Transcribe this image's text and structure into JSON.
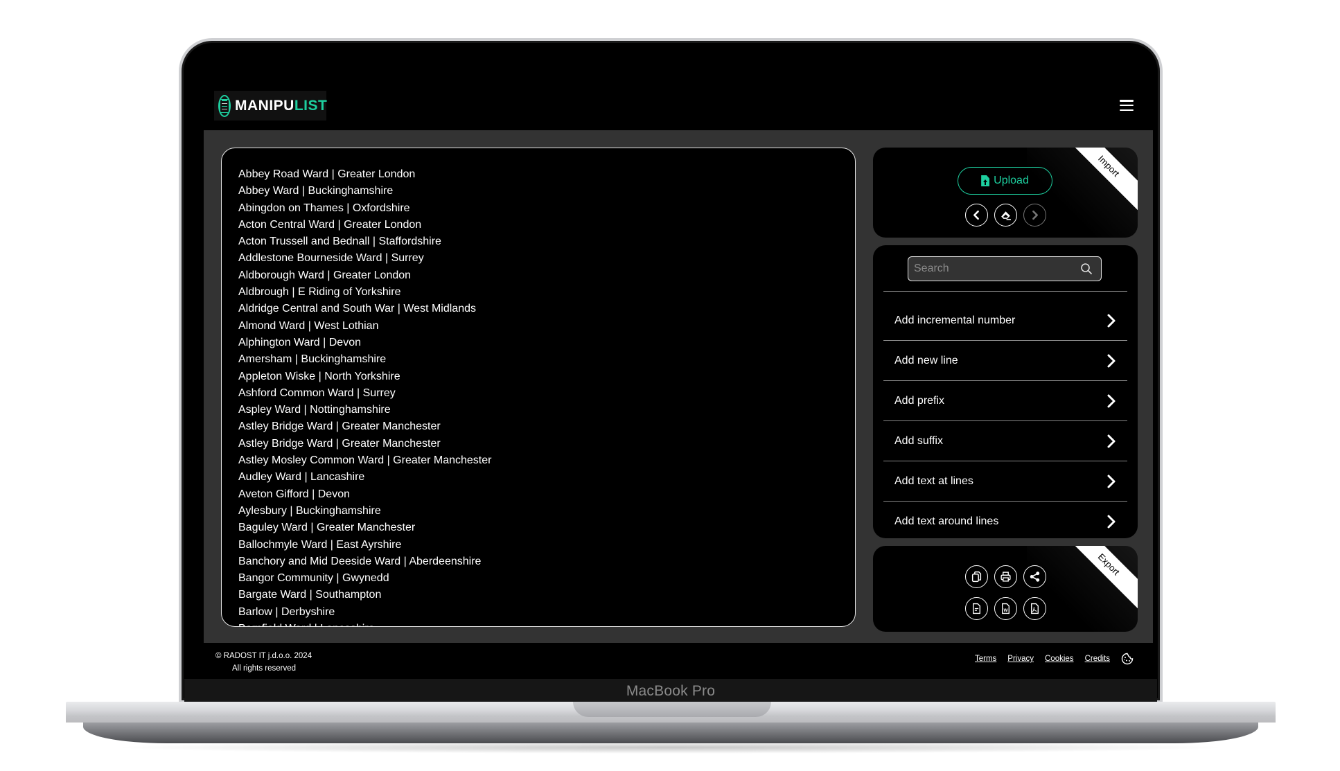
{
  "device": {
    "label": "MacBook Pro"
  },
  "header": {
    "logo_main": "MANIPU",
    "logo_accent": "LIST",
    "menu_icon": "hamburger-menu-icon"
  },
  "list": {
    "lines": [
      "Abbey Road Ward | Greater London",
      "Abbey Ward | Buckinghamshire",
      "Abingdon on Thames | Oxfordshire",
      "Acton Central Ward | Greater London",
      "Acton Trussell and Bednall | Staffordshire",
      "Addlestone Bourneside Ward | Surrey",
      "Aldborough Ward | Greater London",
      "Aldbrough | E Riding of Yorkshire",
      "Aldridge Central and South War | West Midlands",
      "Almond Ward | West Lothian",
      "Alphington Ward | Devon",
      "Amersham | Buckinghamshire",
      "Appleton Wiske | North Yorkshire",
      "Ashford Common Ward | Surrey",
      "Aspley Ward | Nottinghamshire",
      "Astley Bridge Ward | Greater Manchester",
      "Astley Bridge Ward | Greater Manchester",
      "Astley Mosley Common Ward | Greater Manchester",
      "Audley Ward | Lancashire",
      "Aveton Gifford | Devon",
      "Aylesbury | Buckinghamshire",
      "Baguley Ward | Greater Manchester",
      "Ballochmyle Ward | East Ayrshire",
      "Banchory and Mid Deeside Ward | Aberdeenshire",
      "Bangor Community | Gwynedd",
      "Bargate Ward | Southampton",
      "Barlow | Derbyshire",
      "Barnfield Ward | Lancashire"
    ]
  },
  "import_panel": {
    "ribbon": "Import",
    "upload_label": "Upload",
    "accent_color": "#1dcf9f",
    "icons": [
      "undo-icon",
      "eraser-icon",
      "redo-icon"
    ]
  },
  "actions_panel": {
    "search_placeholder": "Search",
    "search_value": "",
    "items": [
      {
        "label": "Add incremental number"
      },
      {
        "label": "Add new line"
      },
      {
        "label": "Add prefix"
      },
      {
        "label": "Add suffix"
      },
      {
        "label": "Add text at lines"
      },
      {
        "label": "Add text around lines"
      }
    ]
  },
  "export_panel": {
    "ribbon": "Export",
    "icons": [
      "copy-icon",
      "print-icon",
      "share-icon",
      "txt-file-icon",
      "word-file-icon",
      "pdf-file-icon"
    ]
  },
  "footer": {
    "copyright": "© RADOST IT j.d.o.o. 2024",
    "rights": "All rights reserved",
    "links": [
      "Terms",
      "Privacy",
      "Cookies",
      "Credits"
    ]
  }
}
